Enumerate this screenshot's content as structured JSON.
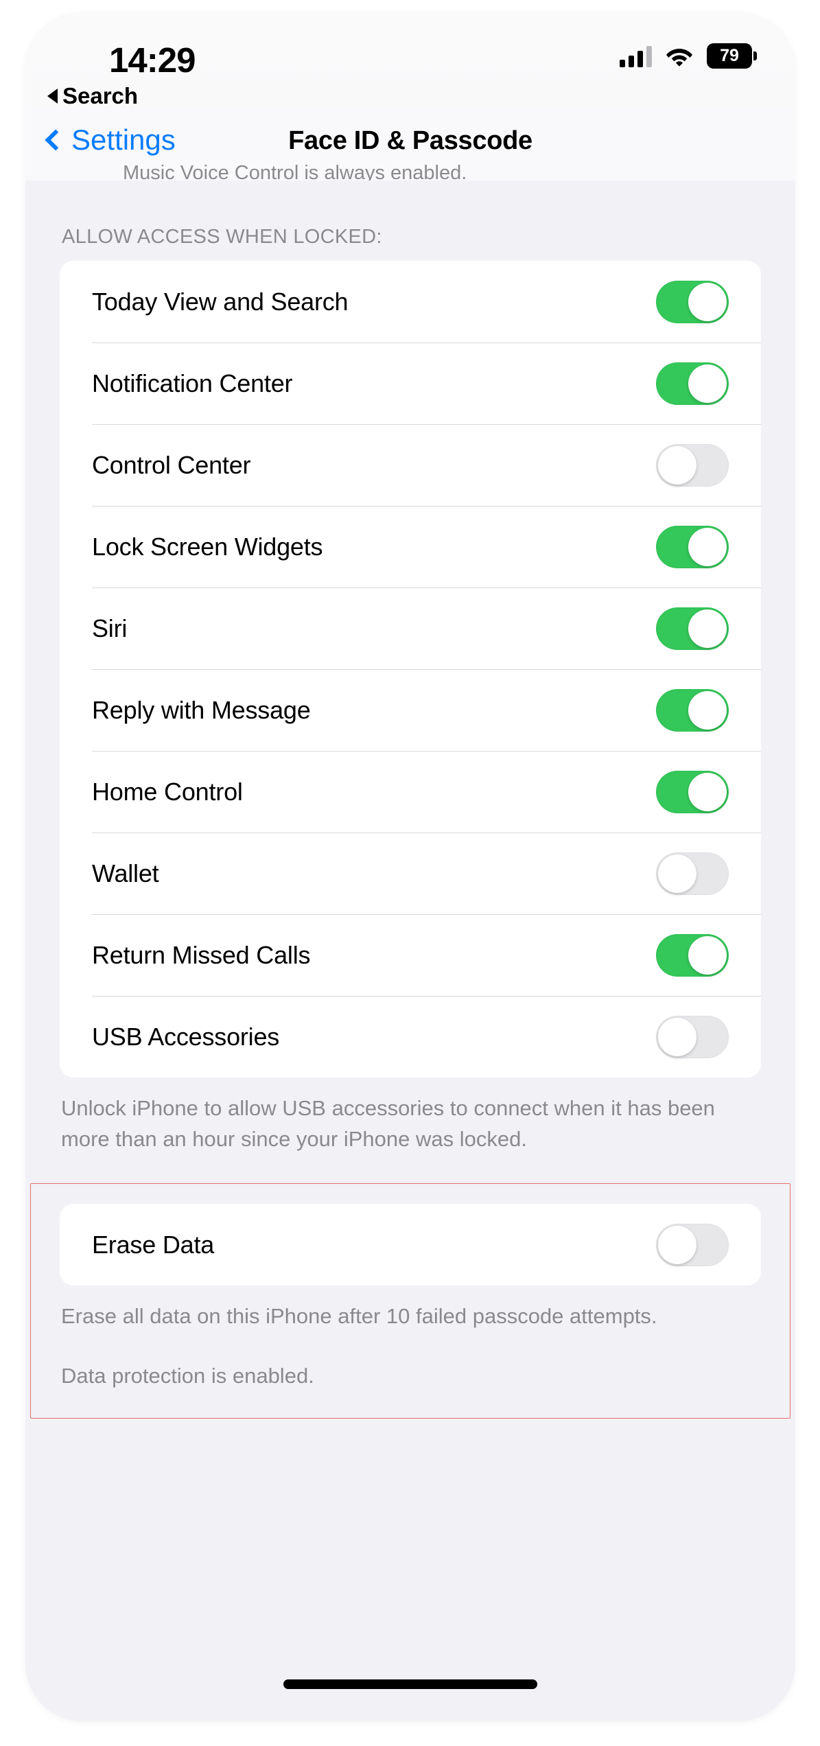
{
  "status_bar": {
    "time": "14:29",
    "back_to_app_label": "Search",
    "back_to_app_icon": "triangle-left-icon",
    "signal_icon": "cellular-signal-icon",
    "wifi_icon": "wifi-icon",
    "battery_level": "79",
    "battery_icon": "battery-icon"
  },
  "nav_bar": {
    "back_label": "Settings",
    "back_icon": "chevron-left-icon",
    "title": "Face ID & Passcode"
  },
  "content": {
    "clipped_footnote_above": "Music Voice Control is always enabled.",
    "allow_access_section": {
      "header": "ALLOW ACCESS WHEN LOCKED:",
      "rows": [
        {
          "label": "Today View and Search",
          "toggle": "on"
        },
        {
          "label": "Notification Center",
          "toggle": "on"
        },
        {
          "label": "Control Center",
          "toggle": "off"
        },
        {
          "label": "Lock Screen Widgets",
          "toggle": "on"
        },
        {
          "label": "Siri",
          "toggle": "on"
        },
        {
          "label": "Reply with Message",
          "toggle": "on"
        },
        {
          "label": "Home Control",
          "toggle": "on"
        },
        {
          "label": "Wallet",
          "toggle": "off"
        },
        {
          "label": "Return Missed Calls",
          "toggle": "on"
        },
        {
          "label": "USB Accessories",
          "toggle": "off"
        }
      ],
      "footnote": "Unlock iPhone to allow USB accessories to connect when it has been more than an hour since your iPhone was locked."
    },
    "erase_section": {
      "row": {
        "label": "Erase Data",
        "toggle": "off"
      },
      "footnote_1": "Erase all data on this iPhone after 10 failed passcode attempts.",
      "footnote_2": "Data protection is enabled.",
      "annotation_color": "#e4706a"
    }
  },
  "colors": {
    "toggle_on": "#34c759",
    "toggle_off": "#e7e7ea",
    "accent_blue": "#0a7cff",
    "page_background": "#f2f1f6",
    "card_background": "#ffffff",
    "secondary_text": "#8a8a8e"
  },
  "home_indicator_icon": "home-indicator-bar"
}
